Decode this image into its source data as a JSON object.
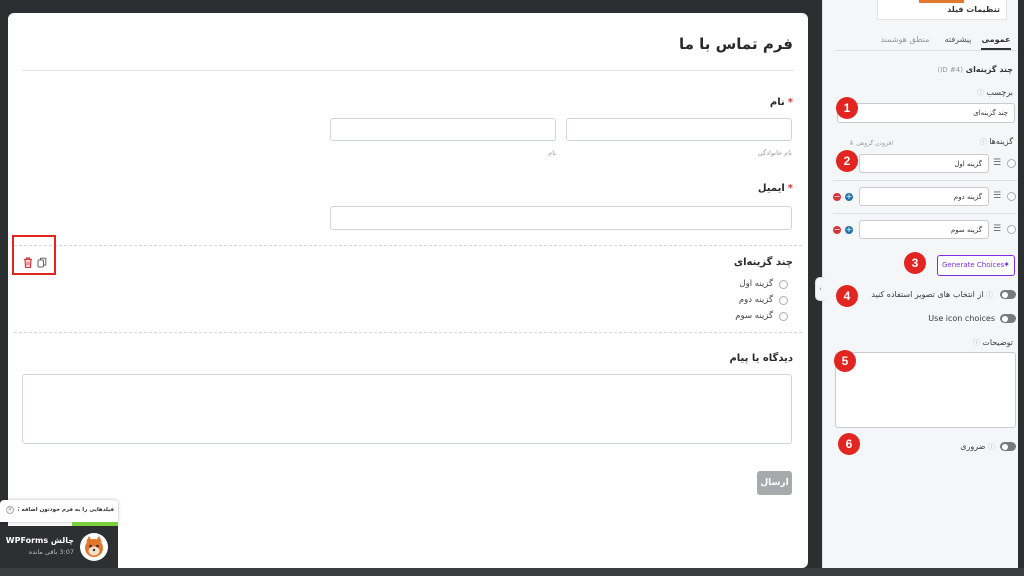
{
  "form": {
    "title": "فرم تماس با ما",
    "fields": {
      "name": {
        "label": "نام",
        "required_mark": "*",
        "first_sublabel": "نام خانوادگی",
        "last_sublabel": "نام"
      },
      "email": {
        "label": "ایمیل",
        "required_mark": "*"
      },
      "multiple_choice": {
        "label": "چند گزینه‌ای",
        "options": [
          "گزینه اول",
          "گزینه دوم",
          "گزینه سوم"
        ]
      },
      "comment": {
        "label": "دیدگاه یا پیام"
      }
    },
    "submit_label": "ارسال",
    "field_actions": {
      "delete_icon": "trash-icon",
      "duplicate_icon": "copy-icon"
    }
  },
  "toast": {
    "text": "فیلدهایی را به فرم خودتون اضافه کنید",
    "close_icon": "close-icon"
  },
  "challenge": {
    "title": "چالش WPForms",
    "subtitle": "باقی مانده",
    "time": "3:07",
    "mascot_icon": "fox-mascot-icon"
  },
  "sidebar": {
    "header": "تنظیمات فیلد",
    "tabs": [
      {
        "label": "عمومی",
        "active": true
      },
      {
        "label": "پیشرفته",
        "active": false
      },
      {
        "label": "منطق هوشمند",
        "active": false
      }
    ],
    "section_title": "چند گزینه‌ای",
    "field_id": "(ID #4)",
    "label_field": {
      "label": "برچسب",
      "value": "چند گزینه‌ای"
    },
    "choices": {
      "label": "گزینه‌ها",
      "bulk_add": "افزودن گروهی",
      "items": [
        "گزینه اول",
        "گزینه دوم",
        "گزینه سوم"
      ]
    },
    "generate_button": "Generate Choices",
    "image_choices_label": "از انتخاب های تصویر استفاده کنید",
    "icon_choices_label": "Use icon choices",
    "description_label": "توضیحات",
    "description_value": "",
    "required_label": "ضروری",
    "help_icon": "question-circle-icon"
  },
  "annotations": [
    "1",
    "2",
    "3",
    "4",
    "5",
    "6"
  ],
  "colors": {
    "annotation_red": "#e32521",
    "highlight_box": "#e32521",
    "generate_purple": "#7a30e2",
    "submit_gray": "#a7aaad",
    "toggle_gray": "#777b80"
  }
}
